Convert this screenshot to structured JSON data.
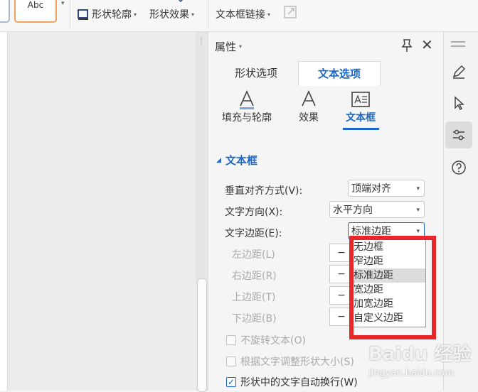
{
  "ribbon": {
    "abc_label": "Abc",
    "shape_outline": "形状轮廓",
    "shape_effect": "形状效果",
    "textbox_link": "文本框链接"
  },
  "panel": {
    "title": "属性",
    "tabs": [
      "形状选项",
      "文本选项"
    ],
    "subtabs": [
      "填充与轮廓",
      "效果",
      "文本框"
    ],
    "section": "文本框",
    "vertical_align_label": "垂直对齐方式(V):",
    "vertical_align_value": "顶端对齐",
    "text_direction_label": "文字方向(X):",
    "text_direction_value": "水平方向",
    "text_margin_label": "文字边距(E):",
    "text_margin_value": "标准边距",
    "left_margin": "左边距(L)",
    "right_margin": "右边距(R)",
    "top_margin": "上边距(T)",
    "bottom_margin": "下边距(B)",
    "spin_minus": "−",
    "no_rotate": "不旋转文本(O)",
    "resize_shape": "根据文字调整形状大小(S)",
    "wrap_text": "形状中的文字自动换行(W)",
    "margin_options": [
      "无边框",
      "窄边距",
      "标准边距",
      "宽边距",
      "加宽边距",
      "自定义边距"
    ],
    "margin_options_visible": [
      "无边框",
      "窄边距",
      "标准边距",
      "宽边距",
      "加宽边距",
      "自定义边距"
    ]
  },
  "watermark": {
    "brand": "Baidu 经验",
    "url": "jingyan.baidu.com"
  },
  "colors": {
    "accent": "#1a66c9",
    "highlight_box": "#e8272b"
  }
}
